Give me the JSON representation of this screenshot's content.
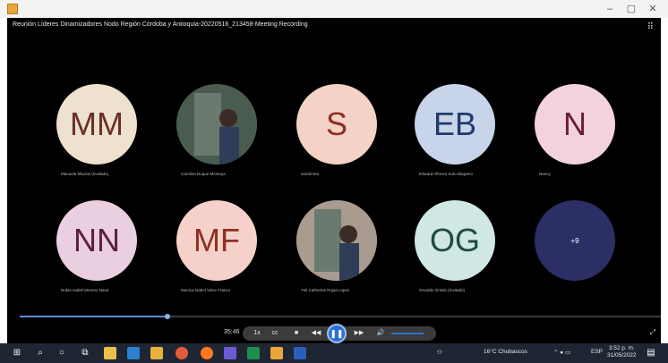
{
  "window": {
    "icon": "app-icon",
    "controls": [
      "–",
      "▢",
      "✕"
    ]
  },
  "recording": {
    "title": "Reunión Líderes Dinamizadores Nodo Región Córdoba y Antioquia-20220516_213458-Meeting Recording"
  },
  "participants": [
    {
      "initials": "MM",
      "name": "Manuela Macías (Invitado)",
      "bg": "#efe1cf",
      "fg": "#6a2f25"
    },
    {
      "initials": "",
      "name": "Carolina Duque Montoya",
      "photo": true,
      "bg": "#4a5c4f"
    },
    {
      "initials": "S",
      "name": "sandrmea",
      "bg": "#f4d2c6",
      "fg": "#8b2f21"
    },
    {
      "initials": "EB",
      "name": "Edward Alfonso Soto Baquero",
      "bg": "#c7d4ea",
      "fg": "#203a6b"
    },
    {
      "initials": "N",
      "name": "Nancy",
      "bg": "#f2d3dd",
      "fg": "#6a1f34"
    },
    {
      "initials": "NN",
      "name": "Nubia Isabel Moreno Nava",
      "bg": "#e9cfdf",
      "fg": "#5b1f3d"
    },
    {
      "initials": "MF",
      "name": "Monica Isabel Velez Franco",
      "bg": "#f6d1c9",
      "fg": "#8c3122"
    },
    {
      "initials": "",
      "name": "Yuli Catherine Rojas Lopez",
      "photo": true,
      "bg": "#a99b8f"
    },
    {
      "initials": "OG",
      "name": "Osvaldo Grisdo (Invitado)",
      "bg": "#cfe8e3",
      "fg": "#1f4a43"
    },
    {
      "initials": "+9",
      "name": "",
      "bg": "#2b2f66",
      "fg": "#ffffff",
      "small": true
    }
  ],
  "playback": {
    "time": "35:46",
    "progress": 0.23,
    "volume": 0.9,
    "buttons": [
      "1x",
      "cc",
      "■",
      "◀◀",
      "▶▶",
      "🔊"
    ],
    "play_icon": "❚❚"
  },
  "taskbar": {
    "weather": "16°C  Chubascos",
    "lang": "ESP",
    "time": "3:52 p. m.",
    "date": "31/05/2022"
  }
}
